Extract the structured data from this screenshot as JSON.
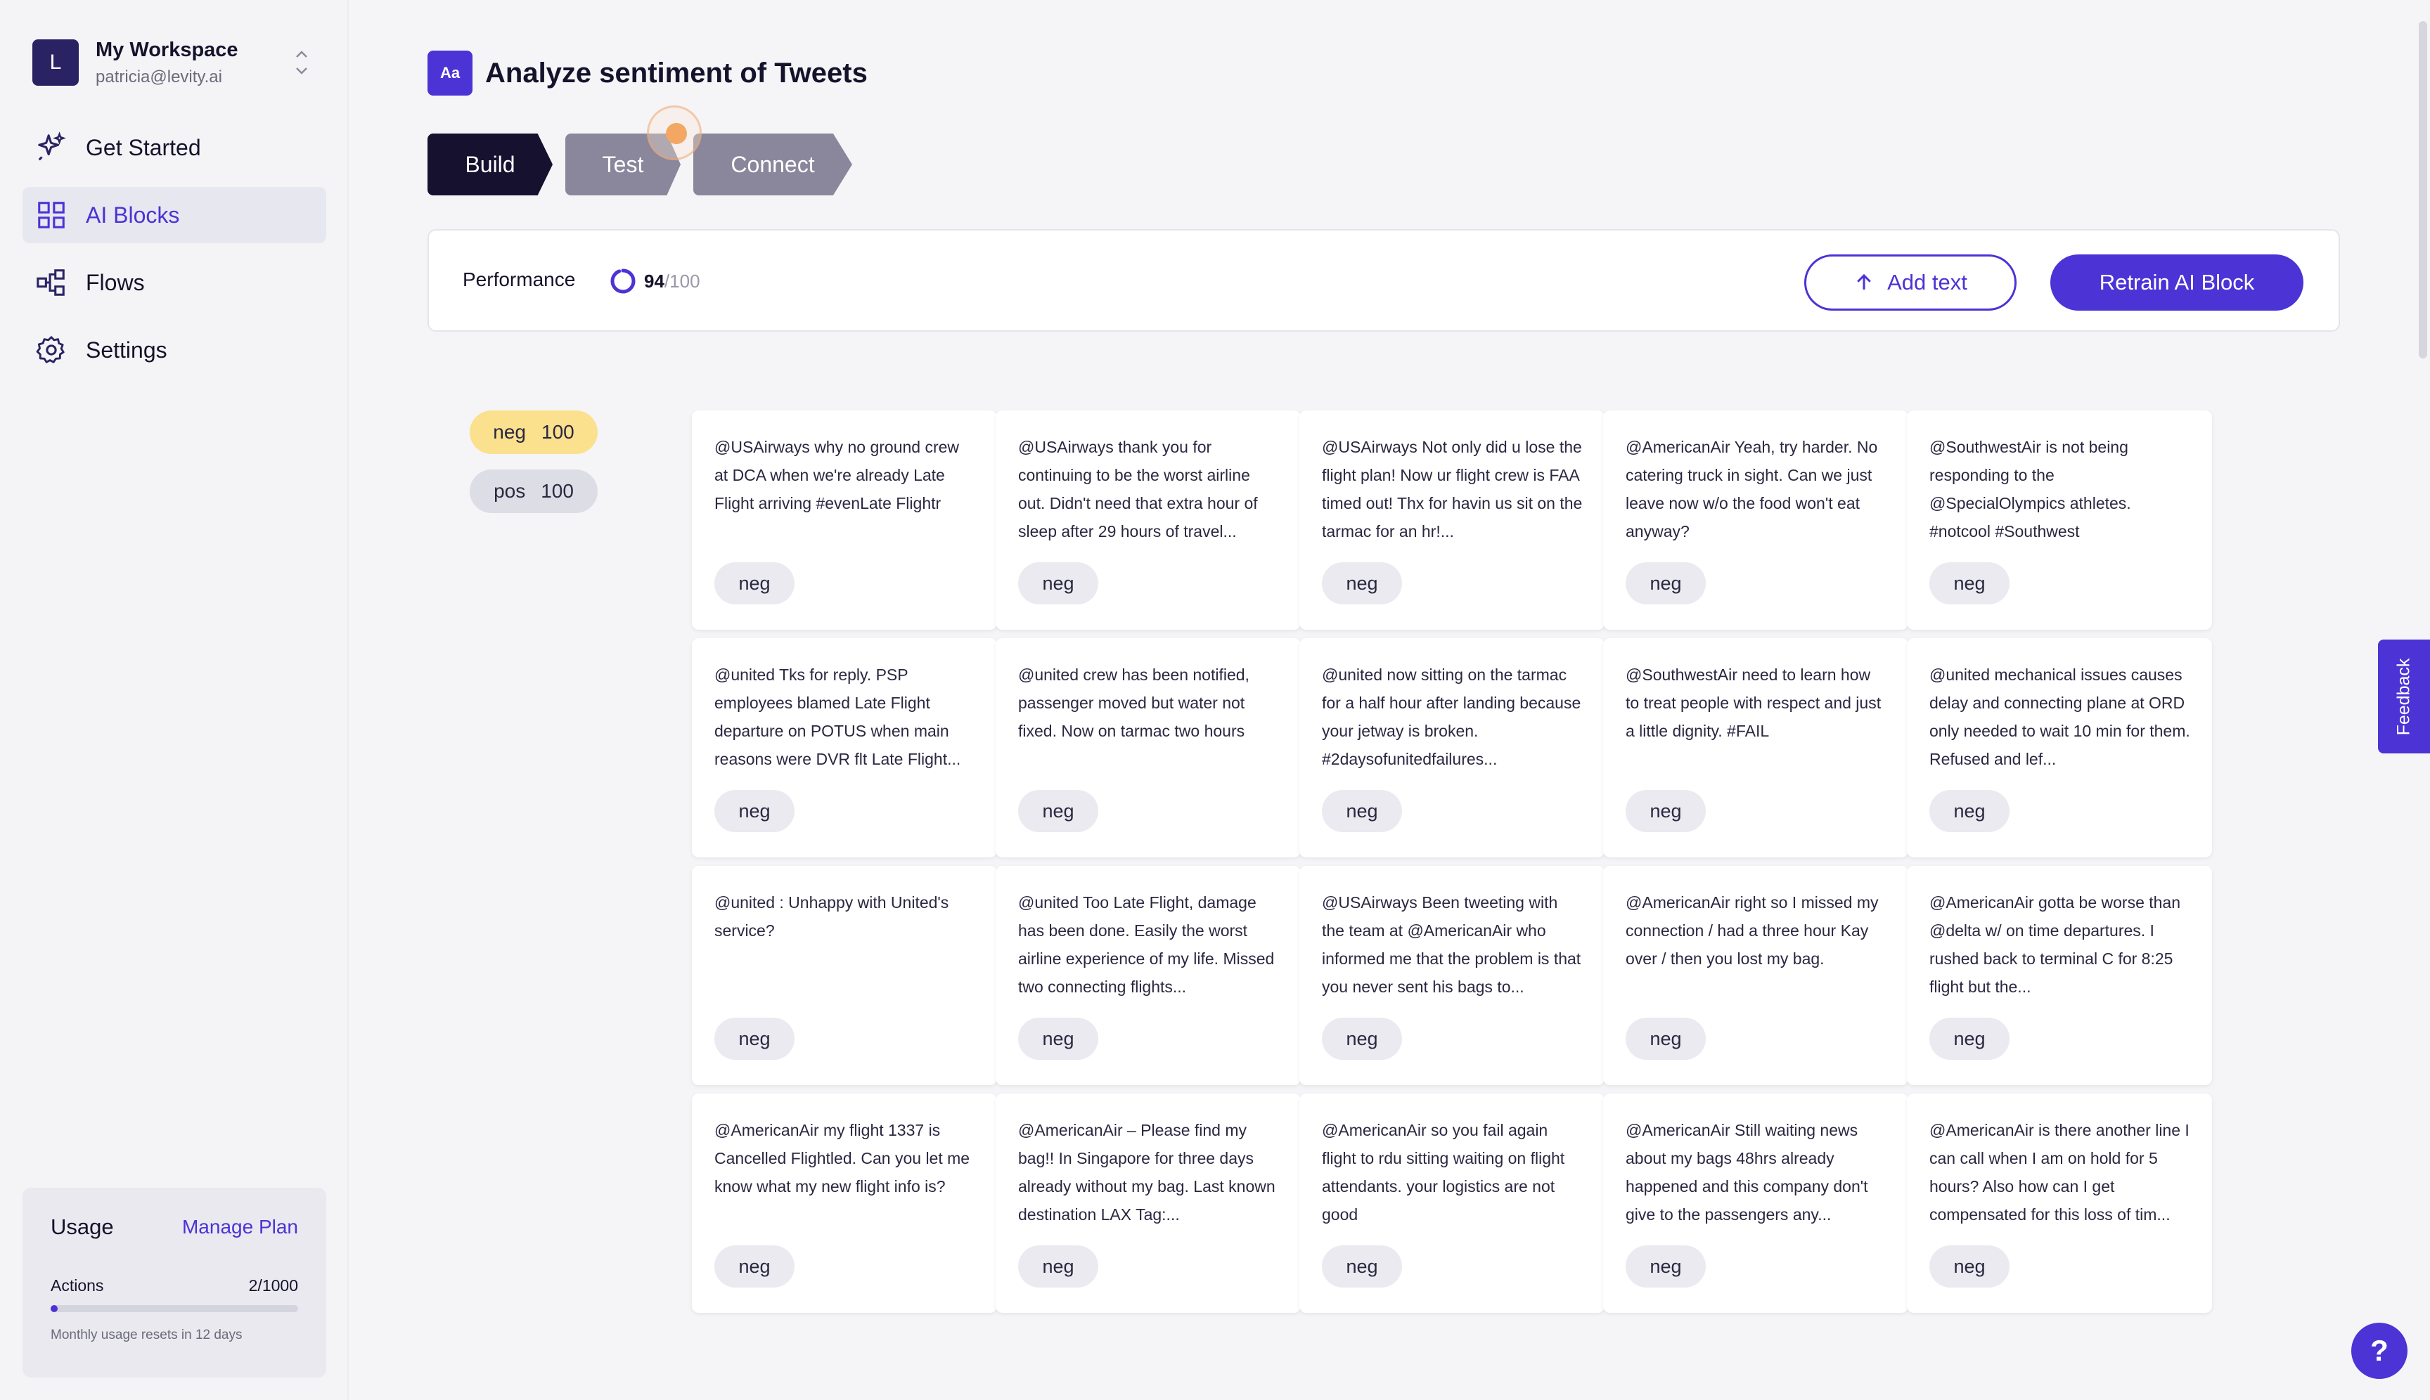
{
  "workspace": {
    "avatar_letter": "L",
    "name": "My Workspace",
    "email": "patricia@levity.ai"
  },
  "nav": [
    {
      "label": "Get Started",
      "icon": "sparkle-icon"
    },
    {
      "label": "AI Blocks",
      "icon": "grid-icon",
      "active": true
    },
    {
      "label": "Flows",
      "icon": "flow-icon"
    },
    {
      "label": "Settings",
      "icon": "gear-icon"
    }
  ],
  "usage": {
    "title": "Usage",
    "manage_label": "Manage Plan",
    "actions_label": "Actions",
    "actions_value": "2/1000",
    "actions_fraction": 0.002,
    "note": "Monthly usage resets in 12 days"
  },
  "page": {
    "title_icon": "Aa",
    "title": "Analyze sentiment of Tweets"
  },
  "steps": [
    {
      "label": "Build"
    },
    {
      "label": "Test"
    },
    {
      "label": "Connect"
    }
  ],
  "performance": {
    "label": "Performance",
    "score": "94",
    "max": "/100",
    "score_fraction": 0.94
  },
  "buttons": {
    "add_text": "Add text",
    "retrain": "Retrain AI Block"
  },
  "filters": [
    {
      "label": "neg",
      "count": "100"
    },
    {
      "label": "pos",
      "count": "100"
    }
  ],
  "cards": [
    {
      "text": "@USAirways why no ground crew at DCA when we're already Late Flight arriving #evenLate Flightr",
      "tag": "neg"
    },
    {
      "text": "@USAirways thank you for continuing to be the worst airline out. Didn't need that extra hour of sleep after 29 hours of travel...",
      "tag": "neg"
    },
    {
      "text": "@USAirways Not only did u lose the flight plan! Now ur flight crew is FAA timed out! Thx for havin us sit on the tarmac for an hr!...",
      "tag": "neg"
    },
    {
      "text": "@AmericanAir Yeah, try harder. No catering truck in sight. Can we just leave now w/o the food won't eat anyway?",
      "tag": "neg"
    },
    {
      "text": "@SouthwestAir is not being responding to the @SpecialOlympics athletes. #notcool #Southwest",
      "tag": "neg"
    },
    {
      "text": "@united Tks for reply. PSP employees blamed Late Flight departure on POTUS when main reasons were DVR flt Late Flight...",
      "tag": "neg"
    },
    {
      "text": "@united crew has been notified, passenger moved but water not fixed. Now on tarmac two hours",
      "tag": "neg"
    },
    {
      "text": "@united now sitting on the tarmac for a half hour after landing because your jetway is broken. #2daysofunitedfailures...",
      "tag": "neg"
    },
    {
      "text": "@SouthwestAir need to learn how to treat people with respect and just a little dignity. #FAIL",
      "tag": "neg"
    },
    {
      "text": "@united mechanical issues causes delay and connecting plane at ORD only needed to wait 10 min for them. Refused and lef...",
      "tag": "neg"
    },
    {
      "text": "@united : Unhappy with United's service?",
      "tag": "neg"
    },
    {
      "text": "@united Too Late Flight, damage has been done. Easily the worst airline experience of my life. Missed two connecting flights...",
      "tag": "neg"
    },
    {
      "text": "@USAirways Been tweeting with the team at @AmericanAir who informed me that the problem is that you never sent his bags to...",
      "tag": "neg"
    },
    {
      "text": "@AmericanAir right so I missed my connection / had a three hour Kay over / then you lost my bag.",
      "tag": "neg"
    },
    {
      "text": "@AmericanAir gotta be worse than @delta w/ on time departures. I rushed back to terminal C for 8:25 flight but the...",
      "tag": "neg"
    },
    {
      "text": "@AmericanAir my flight 1337 is Cancelled Flightled. Can you let me know what my new flight info is?",
      "tag": "neg"
    },
    {
      "text": "@AmericanAir – Please find my bag!! In Singapore for three days already without my bag. Last known destination LAX Tag:...",
      "tag": "neg"
    },
    {
      "text": "@AmericanAir so you fail again flight to rdu sitting waiting on flight attendants. your logistics are not good",
      "tag": "neg"
    },
    {
      "text": "@AmericanAir Still waiting news about my bags 48hrs already happened and this company don't give to the passengers any...",
      "tag": "neg"
    },
    {
      "text": "@AmericanAir is there another line I can call when I am on hold for 5 hours? Also how can I get compensated for this loss of tim...",
      "tag": "neg"
    }
  ],
  "feedback_label": "Feedback",
  "help_label": "?"
}
